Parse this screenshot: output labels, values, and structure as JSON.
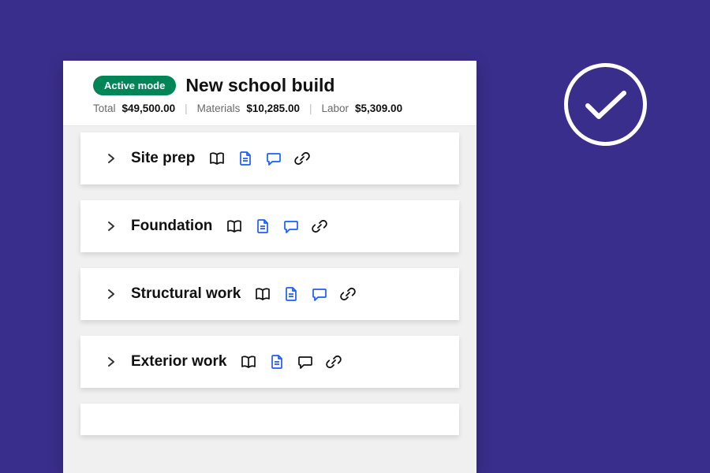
{
  "header": {
    "badge": "Active mode",
    "title": "New school build",
    "summary": {
      "total_label": "Total",
      "total_value": "$49,500.00",
      "materials_label": "Materials",
      "materials_value": "$10,285.00",
      "labor_label": "Labor",
      "labor_value": "$5,309.00"
    }
  },
  "rows": [
    {
      "title": "Site prep",
      "icon_colors": [
        "black",
        "blue",
        "blue",
        "black"
      ]
    },
    {
      "title": "Foundation",
      "icon_colors": [
        "black",
        "blue",
        "blue",
        "black"
      ]
    },
    {
      "title": "Structural work",
      "icon_colors": [
        "black",
        "blue",
        "blue",
        "black"
      ]
    },
    {
      "title": "Exterior work",
      "icon_colors": [
        "black",
        "blue",
        "black",
        "black"
      ]
    }
  ]
}
